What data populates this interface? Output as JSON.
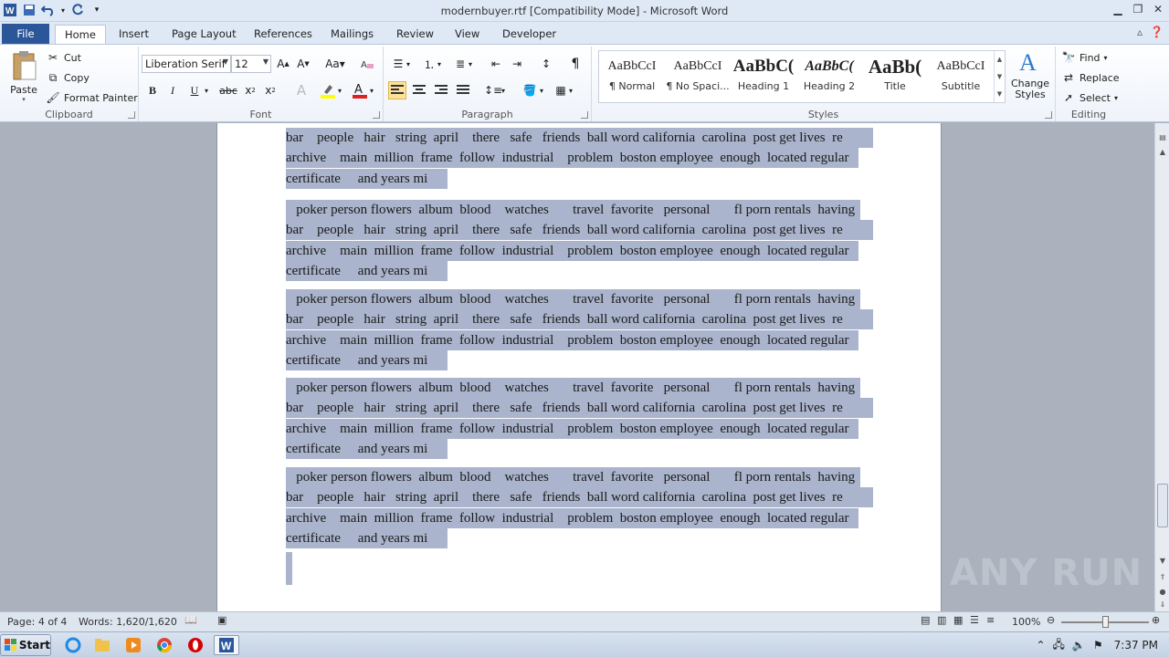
{
  "window": {
    "title": "modernbuyer.rtf [Compatibility Mode]  -  Microsoft Word"
  },
  "tabs": [
    "File",
    "Home",
    "Insert",
    "Page Layout",
    "References",
    "Mailings",
    "Review",
    "View",
    "Developer"
  ],
  "clipboard": {
    "paste": "Paste",
    "cut": "Cut",
    "copy": "Copy",
    "format_painter": "Format Painter",
    "label": "Clipboard"
  },
  "font": {
    "family": "Liberation Serif",
    "size": "12",
    "label": "Font"
  },
  "paragraph": {
    "label": "Paragraph"
  },
  "styles": {
    "label": "Styles",
    "items": [
      {
        "sample": "AaBbCcI",
        "name": "¶ Normal"
      },
      {
        "sample": "AaBbCcI",
        "name": "¶ No Spaci..."
      },
      {
        "sample": "AaBbC(",
        "name": "Heading 1"
      },
      {
        "sample": "AaBbC(",
        "name": "Heading 2"
      },
      {
        "sample": "AaBb(",
        "name": "Title"
      },
      {
        "sample": "AaBbCcI",
        "name": "Subtitle"
      }
    ],
    "change_styles": "Change Styles"
  },
  "editing": {
    "find": "Find",
    "replace": "Replace",
    "select": "Select",
    "label": "Editing"
  },
  "document": {
    "paragraphs": [
      {
        "lines": [
          "bar    people   hair   string  april    there   safe   friends  ball word california  carolina  post get lives  re",
          "archive    main  million  frame  follow  industrial    problem  boston employee  enough  located regular",
          "certificate     and years mi"
        ]
      },
      {
        "lines": [
          "   poker person flowers  album  blood    watches       travel  favorite   personal       fl porn rentals  having",
          "bar    people   hair   string  april    there   safe   friends  ball word california  carolina  post get lives  re",
          "archive    main  million  frame  follow  industrial    problem  boston employee  enough  located regular",
          "certificate     and years mi"
        ]
      },
      {
        "lines": [
          "   poker person flowers  album  blood    watches       travel  favorite   personal       fl porn rentals  having",
          "bar    people   hair   string  april    there   safe   friends  ball word california  carolina  post get lives  re",
          "archive    main  million  frame  follow  industrial    problem  boston employee  enough  located regular",
          "certificate     and years mi"
        ]
      },
      {
        "lines": [
          "   poker person flowers  album  blood    watches       travel  favorite   personal       fl porn rentals  having",
          "bar    people   hair   string  april    there   safe   friends  ball word california  carolina  post get lives  re",
          "archive    main  million  frame  follow  industrial    problem  boston employee  enough  located regular",
          "certificate     and years mi"
        ]
      },
      {
        "lines": [
          "   poker person flowers  album  blood    watches       travel  favorite   personal       fl porn rentals  having",
          "bar    people   hair   string  april    there   safe   friends  ball word california  carolina  post get lives  re",
          "archive    main  million  frame  follow  industrial    problem  boston employee  enough  located regular",
          "certificate     and years mi"
        ]
      }
    ]
  },
  "status": {
    "page": "Page: 4 of 4",
    "words": "Words: 1,620/1,620",
    "zoom": "100%"
  },
  "watermark": "ANY RUN",
  "taskbar": {
    "start": "Start",
    "clock": "7:37 PM"
  },
  "colors": {
    "selection": "#aab4cc",
    "file_tab": "#2b579a",
    "ribbon_bg": "#dfe9f5"
  }
}
